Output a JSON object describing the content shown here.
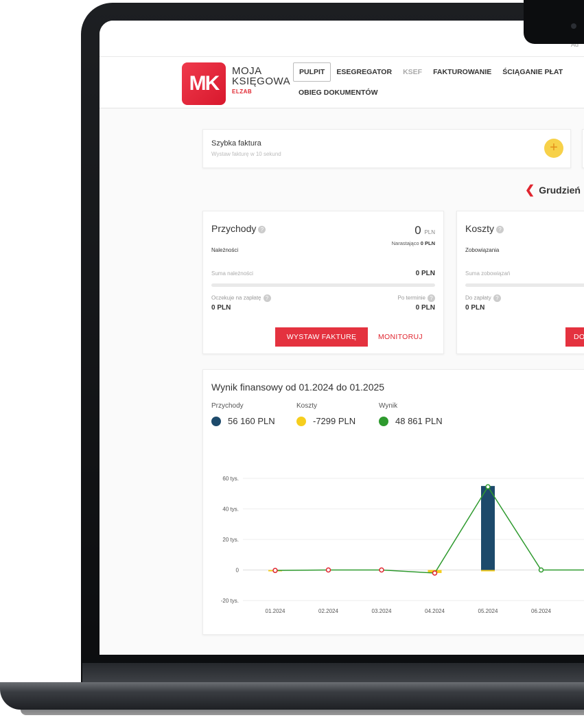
{
  "app": {
    "brand": {
      "logo_text": "MK",
      "line1": "MOJA",
      "line2": "KSIĘGOWA",
      "line3": "ELZAB"
    },
    "topbar_text": "Ad"
  },
  "nav": {
    "items": [
      {
        "label": "PULPIT",
        "active": true
      },
      {
        "label": "ESEGREGATOR"
      },
      {
        "label": "KSEF",
        "dim": true
      },
      {
        "label": "FAKTUROWANIE"
      },
      {
        "label": "ŚCIĄGANIE PŁAT"
      }
    ],
    "second_row": "OBIEG DOKUMENTÓW"
  },
  "quick_invoice": {
    "title": "Szybka faktura",
    "subtitle": "Wystaw fakturę w 10 sekund",
    "plus_icon": "plus-icon"
  },
  "month_nav": {
    "label": "Grudzień"
  },
  "revenue": {
    "title": "Przychody",
    "value": "0",
    "unit": "PLN",
    "cumulative_label": "Narastająco",
    "cumulative_value": "0 PLN",
    "receivables_label": "Należności",
    "sum_label": "Suma należności",
    "sum_value": "0 PLN",
    "waiting_label": "Oczekuje na zapłatę",
    "waiting_value": "0 PLN",
    "overdue_label": "Po terminie",
    "overdue_value": "0 PLN",
    "primary_button": "WYSTAW FAKTURĘ",
    "secondary_button": "MONITORUJ"
  },
  "costs": {
    "title": "Koszty",
    "payables_label": "Zobowiązania",
    "sum_label": "Suma zobowiązań",
    "to_pay_label": "Do zapłaty",
    "to_pay_value": "0 PLN",
    "button": "DO"
  },
  "financial": {
    "title": "Wynik finansowy od 01.2024 do 01.2025",
    "legend": [
      {
        "name": "Przychody",
        "value": "56 160 PLN",
        "color": "#1d4a6b"
      },
      {
        "name": "Koszty",
        "value": "-7299 PLN",
        "color": "#f6ce1e"
      },
      {
        "name": "Wynik",
        "value": "48 861 PLN",
        "color": "#2e9a2e"
      }
    ]
  },
  "chart_data": {
    "type": "bar",
    "categories": [
      "01.2024",
      "02.2024",
      "03.2024",
      "04.2024",
      "05.2024",
      "06.2024"
    ],
    "series": [
      {
        "name": "Przychody",
        "type": "bar",
        "values": [
          0,
          0,
          0,
          0,
          55000,
          0
        ],
        "color": "#1d4a6b"
      },
      {
        "name": "Koszty",
        "type": "bar",
        "values": [
          -300,
          0,
          0,
          -2000,
          -500,
          0
        ],
        "color": "#f6ce1e"
      },
      {
        "name": "Wynik",
        "type": "line",
        "values": [
          -300,
          0,
          0,
          -2000,
          54500,
          0
        ],
        "color": "#2e9a2e"
      }
    ],
    "y_ticks": [
      "60 tys.",
      "40 tys.",
      "20 tys.",
      "0",
      "-20 tys."
    ],
    "y_tick_values": [
      60000,
      40000,
      20000,
      0,
      -20000
    ],
    "ylim": [
      -20000,
      60000
    ],
    "grid": true
  }
}
